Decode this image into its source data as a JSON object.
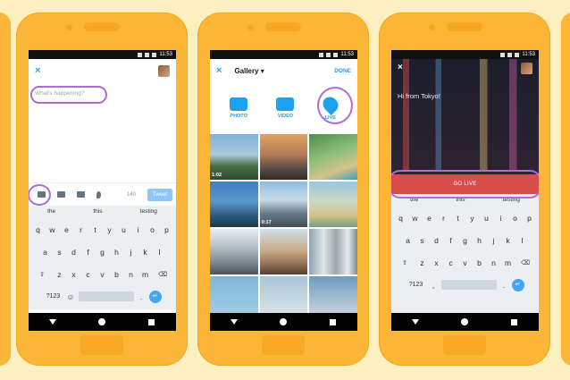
{
  "status": {
    "time": "11:53"
  },
  "phone1": {
    "close_icon": "×",
    "placeholder": "What's happening?",
    "char_count": "140",
    "tweet_label": "Tweet",
    "suggestions": [
      "the",
      "this",
      "testing"
    ],
    "keys_row1": [
      "q",
      "w",
      "e",
      "r",
      "t",
      "y",
      "u",
      "i",
      "o",
      "p"
    ],
    "keys_row2": [
      "a",
      "s",
      "d",
      "f",
      "g",
      "h",
      "j",
      "k",
      "l"
    ],
    "keys_row3": [
      "z",
      "x",
      "c",
      "v",
      "b",
      "n",
      "m"
    ],
    "num_key": "?123",
    "comma": ",",
    "period": "."
  },
  "phone2": {
    "close_icon": "×",
    "title": "Gallery",
    "done_label": "DONE",
    "modes": [
      "PHOTO",
      "VIDEO",
      "LIVE"
    ],
    "durations": [
      "1:02",
      "0:17"
    ]
  },
  "phone3": {
    "close_icon": "×",
    "caption": "Hi from Tokyo!",
    "golive_label": "GO LIVE",
    "suggestions": [
      "the",
      "this",
      "testing"
    ],
    "num_key": "?123"
  },
  "colors": {
    "accent": "#1da1f2",
    "highlight": "#b06bd6",
    "live_red": "#d84c4c",
    "phone": "#fbb637"
  }
}
